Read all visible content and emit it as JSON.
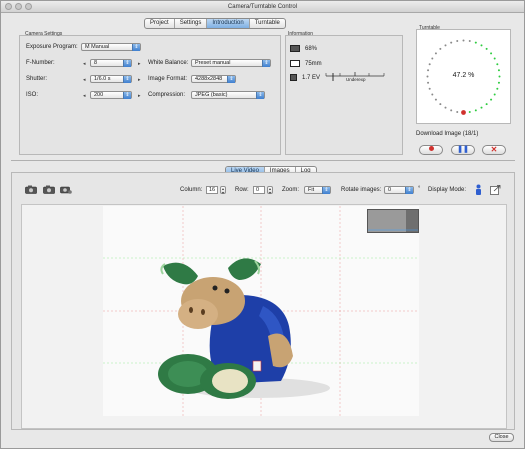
{
  "window": {
    "title": "Camera/Turntable Control"
  },
  "top_tabs": [
    {
      "label": "Project",
      "active": false
    },
    {
      "label": "Settings",
      "active": false
    },
    {
      "label": "Introduction",
      "active": true
    },
    {
      "label": "Turntable",
      "active": false
    }
  ],
  "camera_settings": {
    "title": "Camera Settings",
    "exposure_program": {
      "label": "Exposure Program:",
      "value": "M Manual"
    },
    "f_number": {
      "label": "F-Number:",
      "value": "8"
    },
    "shutter": {
      "label": "Shutter:",
      "value": "1/6.0 s"
    },
    "iso": {
      "label": "ISO:",
      "value": "200"
    },
    "white_balance": {
      "label": "White Balance:",
      "value": "Preset manual"
    },
    "image_format": {
      "label": "Image Format:",
      "value": "4288x2848"
    },
    "compression": {
      "label": "Compression:",
      "value": "JPEG (basic)"
    }
  },
  "information": {
    "title": "Information",
    "battery": "68%",
    "lens": "75mm",
    "ev": "1.7 EV",
    "meter_label": "Underexp"
  },
  "turntable": {
    "title": "Turntable",
    "percent": "47.2 %",
    "progress_fraction": 0.472
  },
  "download": {
    "label": "Download Image (18/1)",
    "record_icon": "record-icon",
    "pause_icon": "pause-icon",
    "cancel_icon": "cancel-icon"
  },
  "view_tabs": [
    {
      "label": "Live Video",
      "active": true
    },
    {
      "label": "Images",
      "active": false
    },
    {
      "label": "Log",
      "active": false
    }
  ],
  "toolbar": {
    "column_label": "Column:",
    "column_value": "16",
    "row_label": "Row:",
    "row_value": "0",
    "zoom_label": "Zoom:",
    "zoom_value": "Fit",
    "rotate_label": "Rotate images:",
    "rotate_value": "0",
    "degree_symbol": "°",
    "display_mode_label": "Display Mode:"
  },
  "colors": {
    "accent": "#3f7fcf",
    "progress_green": "#2ecc40",
    "progress_gray": "#8a8a8a",
    "progress_marker": "#d0312d",
    "record_red": "#d0312d",
    "pause_blue": "#2f5fd0"
  },
  "footer": {
    "close_label": "Close"
  }
}
